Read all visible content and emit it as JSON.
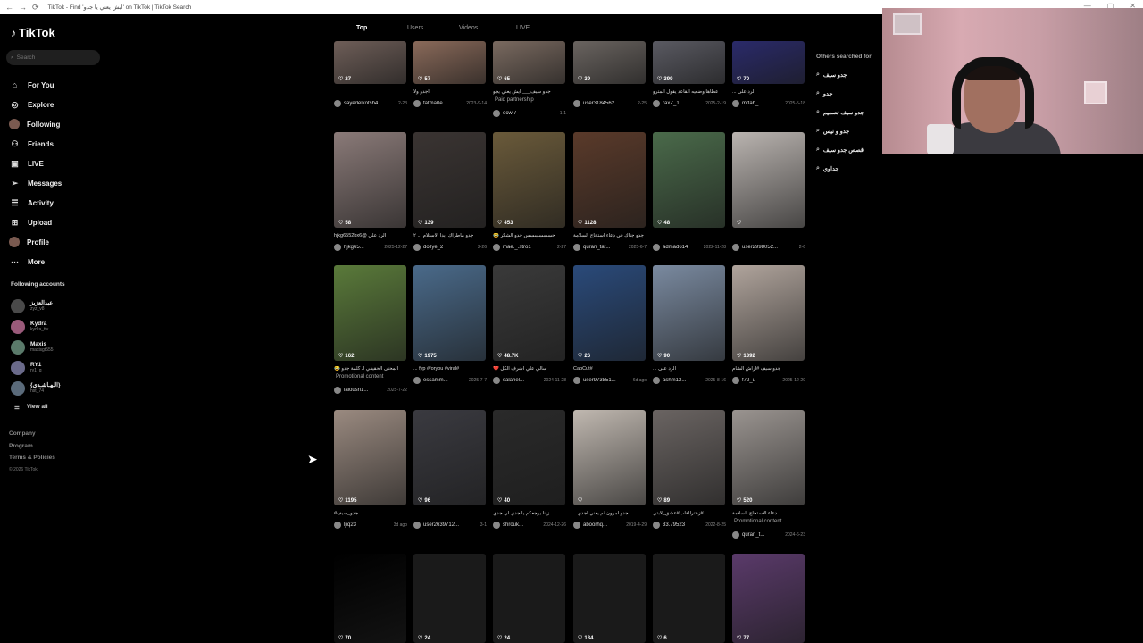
{
  "browser": {
    "title": "TikTok - Find 'ايش يعني يا جدو' on TikTok | TikTok Search",
    "back": "←",
    "forward": "→",
    "reload": "⟳",
    "window_buttons": [
      "—",
      "▢",
      "✕"
    ]
  },
  "sidebar": {
    "brand": "TikTok",
    "search_placeholder": "Search",
    "menu": [
      {
        "label": "For You",
        "icon": "home-icon",
        "glyph": "⌂"
      },
      {
        "label": "Explore",
        "icon": "compass-icon",
        "glyph": "◎"
      },
      {
        "label": "Following",
        "icon": "avatar-icon",
        "glyph": ""
      },
      {
        "label": "Friends",
        "icon": "friends-icon",
        "glyph": "⚇"
      },
      {
        "label": "LIVE",
        "icon": "live-icon",
        "glyph": "▣"
      },
      {
        "label": "Messages",
        "icon": "send-icon",
        "glyph": "➢"
      },
      {
        "label": "Activity",
        "icon": "activity-icon",
        "glyph": "☰"
      },
      {
        "label": "Upload",
        "icon": "upload-icon",
        "glyph": "⊞"
      },
      {
        "label": "Profile",
        "icon": "profile-icon",
        "glyph": ""
      },
      {
        "label": "More",
        "icon": "more-icon",
        "glyph": "⋯"
      }
    ],
    "following_title": "Following accounts",
    "accounts": [
      {
        "name": "عبدالعزيز",
        "handle": "zyz_v8",
        "color": "#4a4a4a"
      },
      {
        "name": "Kydra",
        "handle": "kydra_ttv",
        "color": "#9a5a7a"
      },
      {
        "name": "Maxis",
        "handle": "maxisgt555",
        "color": "#5a7a6a"
      },
      {
        "name": "RY1",
        "handle": "ry1_q",
        "color": "#6a6a8a"
      },
      {
        "name": "{الـهـاشـدي}",
        "handle": "hst_74",
        "color": "#5a6a7a"
      }
    ],
    "view_all": "View all",
    "footer": [
      "Company",
      "Program",
      "Terms & Policies"
    ],
    "copyright": "© 2026 TikTok"
  },
  "tabs": [
    "Top",
    "Users",
    "Videos",
    "LIVE"
  ],
  "active_tab": "Top",
  "videos": [
    {
      "likes": "27",
      "caption": "",
      "user": "sayedelkotsh4",
      "date": "2-23",
      "bg": "#6e5e58"
    },
    {
      "likes": "57",
      "caption": "اجدو ولا",
      "user": "fatma0e...",
      "date": "2023-9-14",
      "bg": "#8a6a5a"
    },
    {
      "likes": "65",
      "caption": "جدو سيف___ ايش يعني يجو",
      "promo": "Paid partnership",
      "user": "ocwi7",
      "date": "1-1",
      "bg": "#7a6a60"
    },
    {
      "likes": "39",
      "caption": "",
      "user": "user3184562...",
      "date": "2-25",
      "bg": "#6a6460"
    },
    {
      "likes": "399",
      "caption": "عطاها وضعيه القاعد يقول المترو",
      "user": "raxZ_1",
      "date": "2025-2-19",
      "bg": "#5a5a62"
    },
    {
      "likes": "70",
      "caption": "الرد على ...",
      "user": "mftah_...",
      "date": "2025-5-18",
      "bg": "#2a2a6a"
    },
    {
      "likes": "58",
      "caption": "الرد على @hjkg6552bx6",
      "user": "hjkg65...",
      "date": "2025-12-27",
      "bg": "#8a7a78"
    },
    {
      "likes": "139",
      "caption": "جدو ماطراك ابدا الاستلام ... ٢",
      "user": "dollye_2",
      "date": "2-26",
      "bg": "#3a3432"
    },
    {
      "likes": "453",
      "caption": "حسسسسسس جدو الشكر 😂",
      "user": "mae._.stro1",
      "date": "2-27",
      "bg": "#6a5a3a"
    },
    {
      "likes": "1128",
      "caption": "جدو جناك في دعاء استخاج السلامة",
      "user": "quran_taf...",
      "date": "2025-6-7",
      "bg": "#5a3a2a"
    },
    {
      "likes": "48",
      "caption": "",
      "user": "admad614",
      "date": "2022-11-28",
      "bg": "#4a6a4a"
    },
    {
      "likes": "",
      "caption": "",
      "user": "user2998052...",
      "date": "2-6",
      "bg": "#bab4b0"
    },
    {
      "likes": "162",
      "caption": "المحنى الحقيقي لـ كلمة جدو 😂",
      "promo": "Promotional content",
      "user": "laloush1...",
      "date": "2025-7-22",
      "bg": "#5a7a3a"
    },
    {
      "likes": "1975",
      "caption": "#fyp #foryou #viral ...",
      "user": "essamm...",
      "date": "2025-7-7",
      "bg": "#4a6a8a"
    },
    {
      "likes": "48.7K",
      "caption": "سالي علي اشرف الكل ❤️",
      "user": "salahel...",
      "date": "2024-11-28",
      "bg": "#3a3a3a"
    },
    {
      "likes": "26",
      "caption": "#CapCut",
      "user": "user973851...",
      "date": "6d ago",
      "bg": "#2a4a7a"
    },
    {
      "likes": "90",
      "caption": "الرد على ...",
      "user": "ashm12...",
      "date": "2025-8-16",
      "bg": "#7a8aa0"
    },
    {
      "likes": "1392",
      "caption": "جدو سيف #اراش الشام",
      "user": "f72_u",
      "date": "2025-12-29",
      "bg": "#b0a49c"
    },
    {
      "likes": "1195",
      "caption": "جدو_سيف#",
      "user": "ljiq23",
      "date": "3d ago",
      "bg": "#9a8a80"
    },
    {
      "likes": "96",
      "caption": "",
      "user": "user2639712...",
      "date": "3-1",
      "bg": "#3a3a40"
    },
    {
      "likes": "40",
      "caption": "زينا يرجعكم يا جدي لي جدي",
      "user": "shrouk...",
      "date": "2024-12-26",
      "bg": "#2a2a2a"
    },
    {
      "likes": "",
      "caption": "جدو أمرون ثم يعني اجدي...",
      "user": "aboorhq...",
      "date": "2019-4-29",
      "bg": "#c0b8b0"
    },
    {
      "likes": "89",
      "caption": "#زعترالقلب#عشق_لابتي",
      "user": "33.79523",
      "date": "2022-8-25",
      "bg": "#6a6462"
    },
    {
      "likes": "520",
      "caption": "دعاء الاستخاج السلامة",
      "promo": "Promotional content",
      "user": "quran_t...",
      "date": "2024-6-23",
      "bg": "#9a9490"
    },
    {
      "likes": "70",
      "caption": "",
      "user": "",
      "date": "",
      "bg": "#000000"
    },
    {
      "likes": "24",
      "caption": "",
      "user": "",
      "date": "",
      "bg": "#1a1a1a"
    },
    {
      "likes": "24",
      "caption": "",
      "user": "",
      "date": "",
      "bg": "#1a1a1a"
    },
    {
      "likes": "134",
      "caption": "",
      "user": "",
      "date": "",
      "bg": "#1a1a1a"
    },
    {
      "likes": "6",
      "caption": "",
      "user": "",
      "date": "",
      "bg": "#1a1a1a"
    },
    {
      "likes": "77",
      "caption": "",
      "user": "",
      "date": "",
      "bg": "#5a3a6a"
    }
  ],
  "others_searched": {
    "title": "Others searched for",
    "items": [
      "جدو سيف",
      "جدو",
      "جدو سيف تصميم",
      "جدو و نيس",
      "قصص جدو سيف",
      "جداوي"
    ]
  },
  "icons": {
    "heart": "♡",
    "search": "⌕"
  }
}
